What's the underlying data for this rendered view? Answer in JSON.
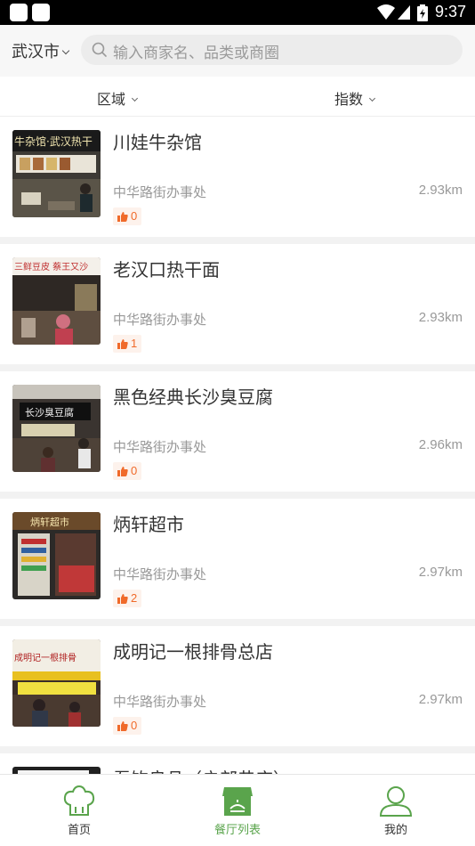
{
  "status_bar": {
    "time": "9:37"
  },
  "header": {
    "city": "武汉市",
    "search_placeholder": "输入商家名、品类或商圈"
  },
  "filters": [
    {
      "label": "区域"
    },
    {
      "label": "指数"
    }
  ],
  "restaurants": [
    {
      "name": "川娃牛杂馆",
      "area": "中华路街办事处",
      "distance": "2.93km",
      "likes": "0"
    },
    {
      "name": "老汉口热干面",
      "area": "中华路街办事处",
      "distance": "2.93km",
      "likes": "1"
    },
    {
      "name": "黑色经典长沙臭豆腐",
      "area": "中华路街办事处",
      "distance": "2.96km",
      "likes": "0"
    },
    {
      "name": "炳轩超市",
      "area": "中华路街办事处",
      "distance": "2.97km",
      "likes": "2"
    },
    {
      "name": "成明记一根排骨总店",
      "area": "中华路街办事处",
      "distance": "2.97km",
      "likes": "0"
    },
    {
      "name": "吾饮良品（户部巷店）",
      "area": "",
      "distance": "",
      "likes": ""
    }
  ],
  "thumb_signs": [
    "牛杂馆·武汉热干",
    "三鲜豆皮 蔡王又沙",
    "长沙臭豆腐",
    "炳轩超市",
    "成明记一根排骨"
  ],
  "tabs": [
    {
      "label": "首页",
      "icon": "chef-hat-icon"
    },
    {
      "label": "餐厅列表",
      "icon": "restaurant-icon"
    },
    {
      "label": "我的",
      "icon": "user-icon"
    }
  ],
  "colors": {
    "accent": "#5aa44c",
    "like": "#f06a2a"
  }
}
